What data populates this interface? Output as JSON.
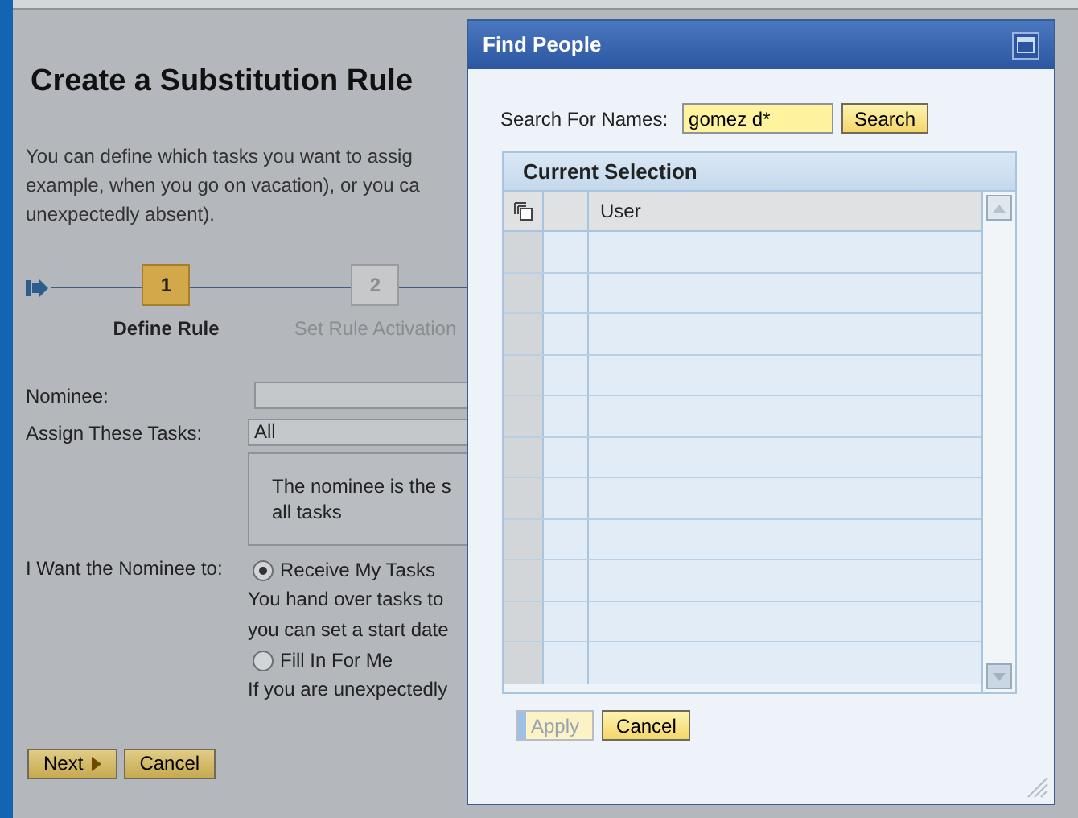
{
  "page": {
    "title": "Create a Substitution Rule",
    "intro_lines": [
      "You can define which tasks you want to assig",
      "example, when you go on vacation), or you ca",
      "unexpectedly absent)."
    ],
    "steps": [
      {
        "number": "1",
        "label": "Define Rule",
        "selected": true
      },
      {
        "number": "2",
        "label": "Set Rule Activation",
        "selected": false
      }
    ],
    "form": {
      "nominee_label": "Nominee:",
      "assign_label": "Assign These Tasks:",
      "assign_value": "All",
      "info_lines": [
        "The nominee is the s",
        "all tasks"
      ],
      "want_label": "I Want the Nominee to:",
      "options": [
        {
          "label": "Receive My Tasks",
          "selected": true,
          "description_lines": [
            "You hand over tasks to",
            "you can set a start date"
          ]
        },
        {
          "label": "Fill In For Me",
          "selected": false,
          "description_lines": [
            "If you are unexpectedly"
          ]
        }
      ]
    },
    "buttons": [
      {
        "label": "Next",
        "kind": "next",
        "disabled": false
      },
      {
        "label": "Cancel",
        "kind": "plain",
        "disabled": false
      }
    ]
  },
  "dialog": {
    "title": "Find People",
    "search_label": "Search For Names:",
    "search_value": "gomez d*",
    "search_button": "Search",
    "panel_title": "Current Selection",
    "columns": [
      "User"
    ],
    "buttons": [
      {
        "label": "Apply",
        "disabled": true
      },
      {
        "label": "Cancel",
        "disabled": false
      }
    ]
  }
}
